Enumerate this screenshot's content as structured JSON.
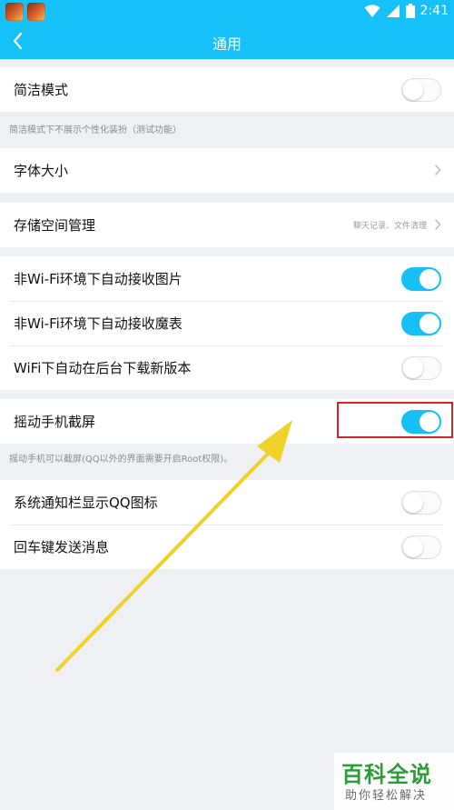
{
  "status_bar": {
    "time": "2:41",
    "icons": [
      "game-app-icon-1",
      "game-app-icon-2",
      "wifi-icon",
      "cellular-signal-icon",
      "battery-icon"
    ]
  },
  "header": {
    "title": "通用",
    "back_icon": "chevron-left-icon"
  },
  "settings": {
    "simple_mode": {
      "label": "简洁模式",
      "toggle_on": false,
      "note": "简洁模式下不展示个性化装扮（测试功能）"
    },
    "font_size": {
      "label": "字体大小"
    },
    "storage": {
      "label": "存储空间管理",
      "detail": "聊天记录、文件清理"
    },
    "auto_receive_images": {
      "label": "非Wi-Fi环境下自动接收图片",
      "toggle_on": true
    },
    "auto_receive_magic": {
      "label": "非Wi-Fi环境下自动接收魔表",
      "toggle_on": true
    },
    "wifi_auto_update": {
      "label": "WiFi下自动在后台下载新版本",
      "toggle_on": false
    },
    "shake_screenshot": {
      "label": "摇动手机截屏",
      "toggle_on": true,
      "note": "摇动手机可以截屏(QQ以外的界面需要开启Root权限)。"
    },
    "notify_qq_icon": {
      "label": "系统通知栏显示QQ图标",
      "toggle_on": false
    },
    "enter_send": {
      "label": "回车键发送消息",
      "toggle_on": false
    }
  },
  "colors": {
    "accent": "#17c0f4",
    "header": "#16c0f8",
    "annotation_box": "#d8222a",
    "arrow": "#f0d22a",
    "watermark": "#2e9b3a"
  },
  "watermark": {
    "main": "百科全说",
    "sub": "助你轻松解决"
  }
}
